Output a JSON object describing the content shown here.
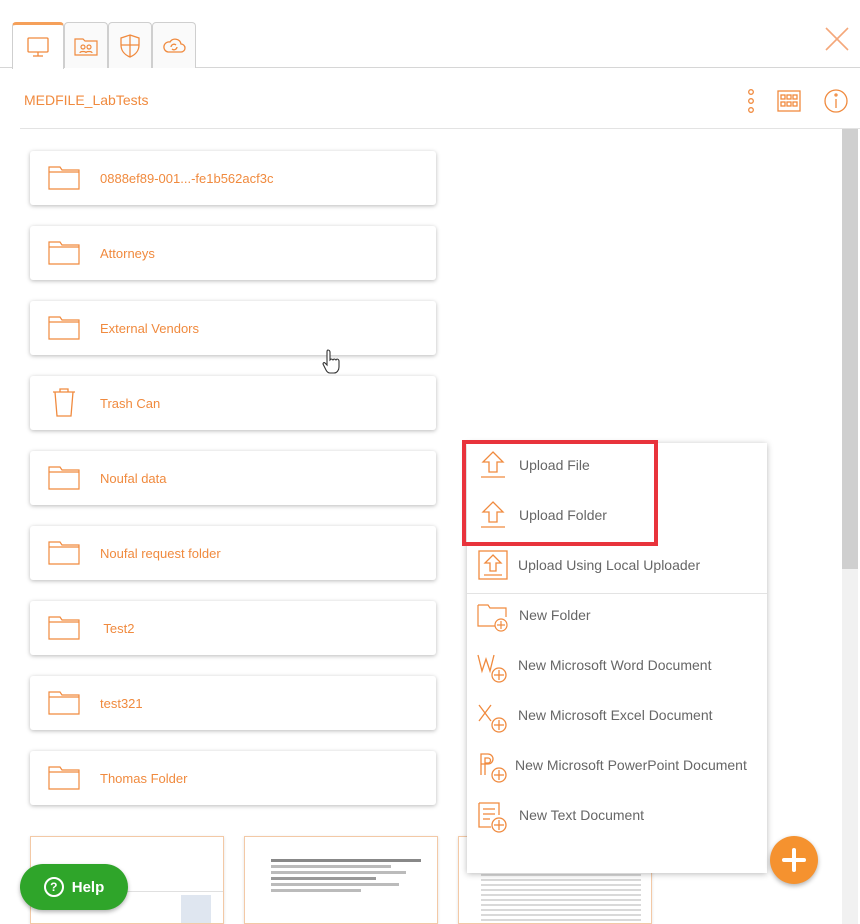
{
  "tabs": [
    {
      "icon": "monitor-icon",
      "active": true
    },
    {
      "icon": "shared-folder-icon",
      "active": false
    },
    {
      "icon": "shield-icon",
      "active": false
    },
    {
      "icon": "cloud-sync-icon",
      "active": false
    }
  ],
  "header": {
    "breadcrumb": "MEDFILE_LabTests",
    "icons": [
      "more-vertical-icon",
      "grid-view-icon",
      "info-icon"
    ]
  },
  "folders": [
    {
      "label": "0888ef89-001...-fe1b562acf3c",
      "icon": "folder-icon"
    },
    {
      "label": "Attorneys",
      "icon": "folder-icon"
    },
    {
      "label": "External Vendors",
      "icon": "folder-icon"
    },
    {
      "label": "Trash Can",
      "icon": "trash-icon"
    },
    {
      "label": "Noufal data",
      "icon": "folder-icon"
    },
    {
      "label": "Noufal request folder",
      "icon": "folder-icon"
    },
    {
      "label": " Test2",
      "icon": "folder-icon"
    },
    {
      "label": "test321",
      "icon": "folder-icon"
    },
    {
      "label": "Thomas Folder",
      "icon": "folder-icon"
    }
  ],
  "menu": {
    "items": [
      {
        "label": "Upload File",
        "icon": "upload-icon"
      },
      {
        "label": "Upload Folder",
        "icon": "upload-icon"
      },
      {
        "label": "Upload Using Local Uploader",
        "icon": "local-uploader-icon"
      },
      {
        "label": "New Folder",
        "icon": "new-folder-icon"
      },
      {
        "label": "New Microsoft Word Document",
        "icon": "word-add-icon"
      },
      {
        "label": "New Microsoft Excel Document",
        "icon": "excel-add-icon"
      },
      {
        "label": "New Microsoft PowerPoint Document",
        "icon": "powerpoint-add-icon"
      },
      {
        "label": "New Text Document",
        "icon": "text-add-icon"
      }
    ]
  },
  "help": {
    "label": "Help"
  },
  "colors": {
    "accent": "#f08a3e",
    "help": "#2fa52a",
    "highlight": "#e8333c"
  }
}
